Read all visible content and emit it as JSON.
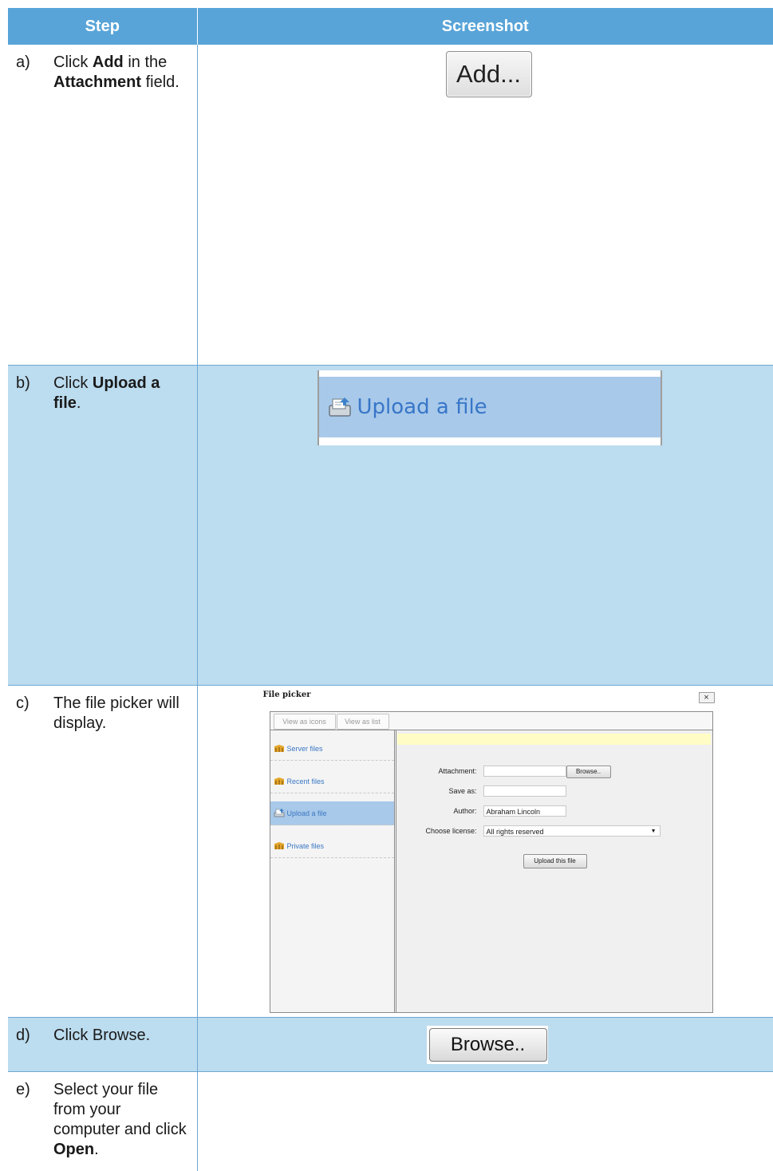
{
  "table": {
    "headers": {
      "step": "Step",
      "screenshot": "Screenshot"
    },
    "rows": [
      {
        "letter": "a)",
        "parts": [
          {
            "t": "Click ",
            "b": false
          },
          {
            "t": "Add",
            "b": true
          },
          {
            "t": " in the ",
            "b": false
          },
          {
            "t": "Attachment",
            "b": true
          },
          {
            "t": " field.",
            "b": false
          }
        ]
      },
      {
        "letter": "b)",
        "parts": [
          {
            "t": "Click ",
            "b": false
          },
          {
            "t": "Upload a file",
            "b": true
          },
          {
            "t": ".",
            "b": false
          }
        ]
      },
      {
        "letter": "c)",
        "parts": [
          {
            "t": "The file picker will display.",
            "b": false
          }
        ]
      },
      {
        "letter": "d)",
        "parts": [
          {
            "t": "Click Browse.",
            "b": false
          }
        ]
      },
      {
        "letter": "e)",
        "parts": [
          {
            "t": "Select your file from your computer and click ",
            "b": false
          },
          {
            "t": "Open",
            "b": true
          },
          {
            "t": ".",
            "b": false
          }
        ]
      }
    ]
  },
  "shot_a": {
    "add_label": "Add..."
  },
  "shot_b": {
    "upload_label": "Upload a file",
    "icon": "upload-icon"
  },
  "shot_c": {
    "title": "File picker",
    "close": "×",
    "toolbar": {
      "view_icons": "View as icons",
      "view_list": "View as list"
    },
    "nav": [
      {
        "label": "Server files",
        "icon": "server-files-icon"
      },
      {
        "label": "Recent files",
        "icon": "recent-files-icon"
      },
      {
        "label": "Upload a file",
        "icon": "upload-icon"
      },
      {
        "label": "Private files",
        "icon": "private-files-icon"
      }
    ],
    "form": {
      "attachment_label": "Attachment:",
      "browse_label": "Browse..",
      "saveas_label": "Save as:",
      "author_label": "Author:",
      "author_value": "Abraham Lincoln",
      "license_label": "Choose license:",
      "license_value": "All rights reserved",
      "upload_button": "Upload this file"
    }
  },
  "shot_d": {
    "browse_label": "Browse.."
  }
}
